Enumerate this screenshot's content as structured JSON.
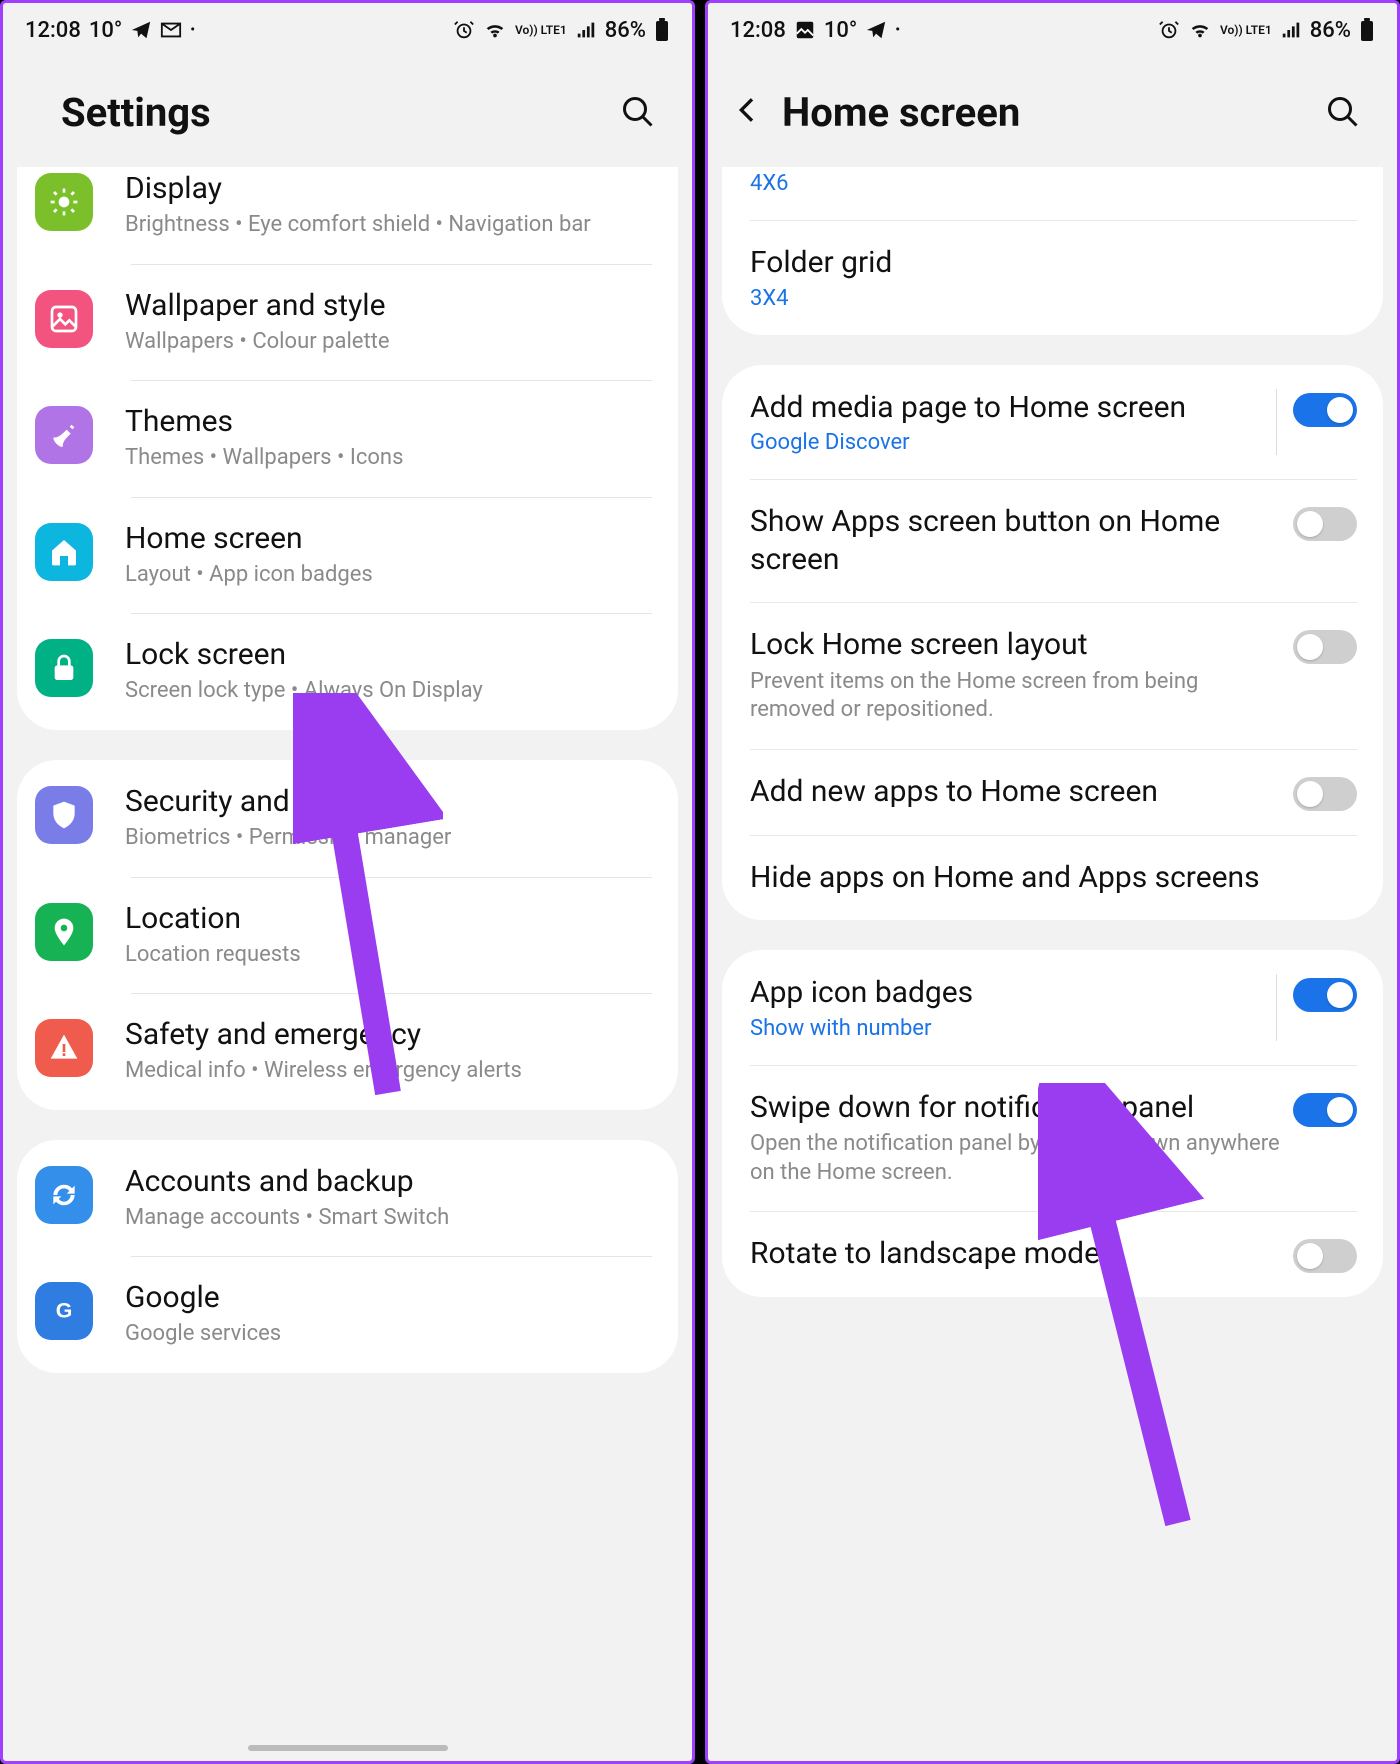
{
  "status": {
    "time": "12:08",
    "temp": "10°",
    "battery": "86%",
    "volte": "Vo)) LTE1"
  },
  "left": {
    "title": "Settings",
    "groups": [
      {
        "items": [
          {
            "id": "display",
            "title": "Display",
            "sub": "Brightness  •  Eye comfort shield  •  Navigation bar",
            "color": "c-green",
            "icon": "sun"
          },
          {
            "id": "wallpaper",
            "title": "Wallpaper and style",
            "sub": "Wallpapers  •  Colour palette",
            "color": "c-pink",
            "icon": "image"
          },
          {
            "id": "themes",
            "title": "Themes",
            "sub": "Themes  •  Wallpapers  •  Icons",
            "color": "c-purple",
            "icon": "brush"
          },
          {
            "id": "home",
            "title": "Home screen",
            "sub": "Layout  •  App icon badges",
            "color": "c-cyan",
            "icon": "home"
          },
          {
            "id": "lock",
            "title": "Lock screen",
            "sub": "Screen lock type  •  Always On Display",
            "color": "c-teal",
            "icon": "lock"
          }
        ]
      },
      {
        "items": [
          {
            "id": "security",
            "title": "Security and privacy",
            "sub": "Biometrics  •  Permission manager",
            "color": "c-violet",
            "icon": "shield"
          },
          {
            "id": "location",
            "title": "Location",
            "sub": "Location requests",
            "color": "c-green2",
            "icon": "pin"
          },
          {
            "id": "safety",
            "title": "Safety and emergency",
            "sub": "Medical info  •  Wireless emergency alerts",
            "color": "c-red",
            "icon": "alert"
          }
        ]
      },
      {
        "items": [
          {
            "id": "accounts",
            "title": "Accounts and backup",
            "sub": "Manage accounts  •  Smart Switch",
            "color": "c-blue",
            "icon": "sync"
          },
          {
            "id": "google",
            "title": "Google",
            "sub": "Google services",
            "color": "c-ggl",
            "icon": "google"
          }
        ]
      }
    ]
  },
  "right": {
    "title": "Home screen",
    "rows": [
      {
        "id": "appsgrid",
        "title": "",
        "value": "4X6",
        "partial": true
      },
      {
        "id": "foldergrid",
        "title": "Folder grid",
        "value": "3X4"
      },
      {
        "sep": true
      },
      {
        "id": "mediapage",
        "title": "Add media page to Home screen",
        "value": "Google Discover",
        "toggle": true,
        "on": true,
        "vbar": true
      },
      {
        "id": "appsbtn",
        "title": "Show Apps screen button on Home screen",
        "toggle": true,
        "on": false
      },
      {
        "id": "locklayout",
        "title": "Lock Home screen layout",
        "sub": "Prevent items on the Home screen from being removed or repositioned.",
        "toggle": true,
        "on": false
      },
      {
        "id": "addnew",
        "title": "Add new apps to Home screen",
        "toggle": true,
        "on": false
      },
      {
        "id": "hideapps",
        "title": "Hide apps on Home and Apps screens"
      },
      {
        "sep": true
      },
      {
        "id": "badges",
        "title": "App icon badges",
        "value": "Show with number",
        "toggle": true,
        "on": true,
        "vbar": true
      },
      {
        "id": "swipedown",
        "title": "Swipe down for notification panel",
        "sub": "Open the notification panel by swiping down anywhere on the Home screen.",
        "toggle": true,
        "on": true
      },
      {
        "id": "rotate",
        "title": "Rotate to landscape mode",
        "toggle": true,
        "on": false
      }
    ]
  }
}
